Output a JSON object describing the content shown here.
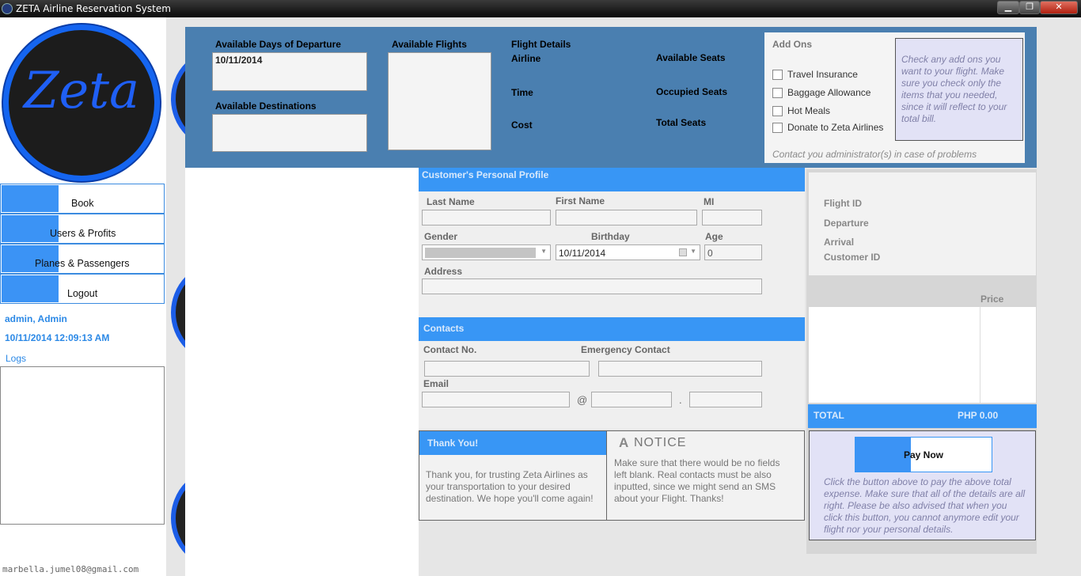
{
  "window": {
    "title": "ZETA Airline Reservation System",
    "min": "▁",
    "max": "❐",
    "close": "✕"
  },
  "logo": {
    "text": "Zeta"
  },
  "nav": [
    {
      "label": "Book"
    },
    {
      "label": "Users & Profits"
    },
    {
      "label": "Planes & Passengers"
    },
    {
      "label": "Logout"
    }
  ],
  "user": {
    "name": "admin, Admin",
    "datetime": "10/11/2014 12:09:13 AM",
    "logs_label": "Logs"
  },
  "footer_email": "marbella.jumel08@gmail.com",
  "flight_search": {
    "days_label": "Available Days of Departure",
    "days_value": "10/11/2014",
    "destinations_label": "Available Destinations",
    "flights_label": "Available Flights"
  },
  "flight_details": {
    "title": "Flight Details",
    "airline": "Airline",
    "time": "Time",
    "cost": "Cost",
    "available_seats": "Available Seats",
    "occupied_seats": "Occupied Seats",
    "total_seats": "Total Seats"
  },
  "addons": {
    "title": "Add Ons",
    "items": [
      {
        "label": "Travel Insurance"
      },
      {
        "label": "Baggage Allowance"
      },
      {
        "label": "Hot Meals"
      },
      {
        "label": "Donate to Zeta Airlines"
      }
    ],
    "note": "Check any add ons you want to your flight. Make sure you check only the  items that you needed, since it will reflect to your total bill.",
    "contact": "Contact you administrator(s) in case of problems"
  },
  "profile": {
    "title": "Customer's Personal Profile",
    "last_name": "Last Name",
    "first_name": "First Name",
    "mi": "MI",
    "gender": "Gender",
    "birthday": "Birthday",
    "birthday_value": "10/11/2014",
    "age": "Age",
    "age_value": "0",
    "address": "Address"
  },
  "contacts": {
    "title": "Contacts",
    "contact_no": "Contact No.",
    "emergency": "Emergency Contact",
    "email": "Email",
    "at": "@",
    "dot": "."
  },
  "thanks": {
    "title": "Thank You!",
    "text": "Thank you, for trusting Zeta Airlines as your transportation to your desired destination. We hope you'll come again!"
  },
  "notice": {
    "title": "NOTICE",
    "icon": "A",
    "text": "Make sure that there would be no fields left blank. Real contacts must be also inputted, since we might send an SMS about your Flight. Thanks!"
  },
  "summary": {
    "flight_id": "Flight ID",
    "departure": "Departure",
    "arrival": "Arrival",
    "customer_id": "Customer ID",
    "price_col": "Price",
    "total_label": "TOTAL",
    "total_value": "PHP  0.00"
  },
  "pay": {
    "button": "Pay Now",
    "note": "Click the button above to pay the above total expense. Make sure that all of the details are all right. Please be also advised that when you click this button, you cannot anymore edit your flight nor your personal details."
  },
  "colors": {
    "accent": "#3896f5",
    "top_panel": "#4a7fb0",
    "logo_ring": "#1565f0"
  }
}
